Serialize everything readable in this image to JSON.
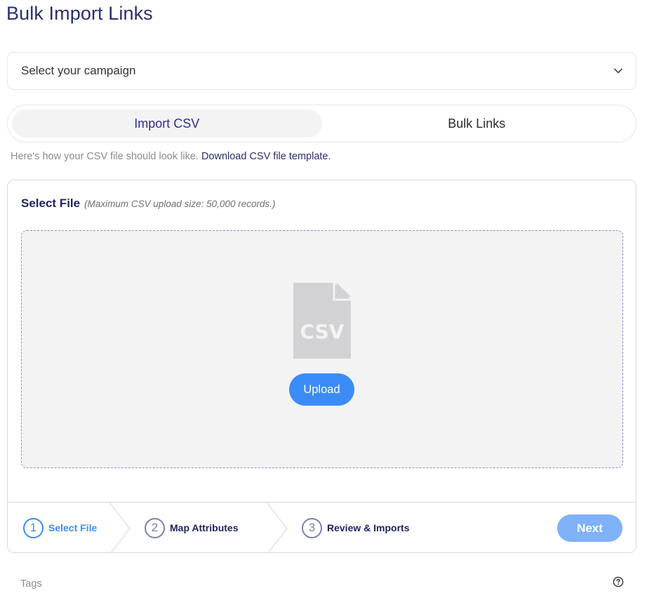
{
  "page": {
    "title": "Bulk Import Links"
  },
  "campaign": {
    "placeholder": "Select your campaign",
    "icon": "chevron-down-icon"
  },
  "tabs": [
    {
      "label": "Import CSV",
      "active": true
    },
    {
      "label": "Bulk Links",
      "active": false
    }
  ],
  "hint": {
    "text": "Here's how your CSV file should look like.",
    "link": "Download CSV file template."
  },
  "select_file": {
    "title": "Select File",
    "note": "(Maximum CSV upload size: 50,000 records.)",
    "file_icon": "csv-file-icon",
    "file_icon_text": "CSV",
    "upload_label": "Upload"
  },
  "stepper": {
    "steps": [
      {
        "num": "1",
        "label": "Select File",
        "state": "active"
      },
      {
        "num": "2",
        "label": "Map Attributes",
        "state": "pending"
      },
      {
        "num": "3",
        "label": "Review & Imports",
        "state": "pending"
      }
    ],
    "next_label": "Next"
  },
  "tags": {
    "label": "Tags",
    "help_icon": "help-circle-icon"
  },
  "colors": {
    "title": "#2a2f6e",
    "accent": "#3c8cf7",
    "next_disabled": "#7fb2f8",
    "active_tab_text": "#2e3192"
  }
}
